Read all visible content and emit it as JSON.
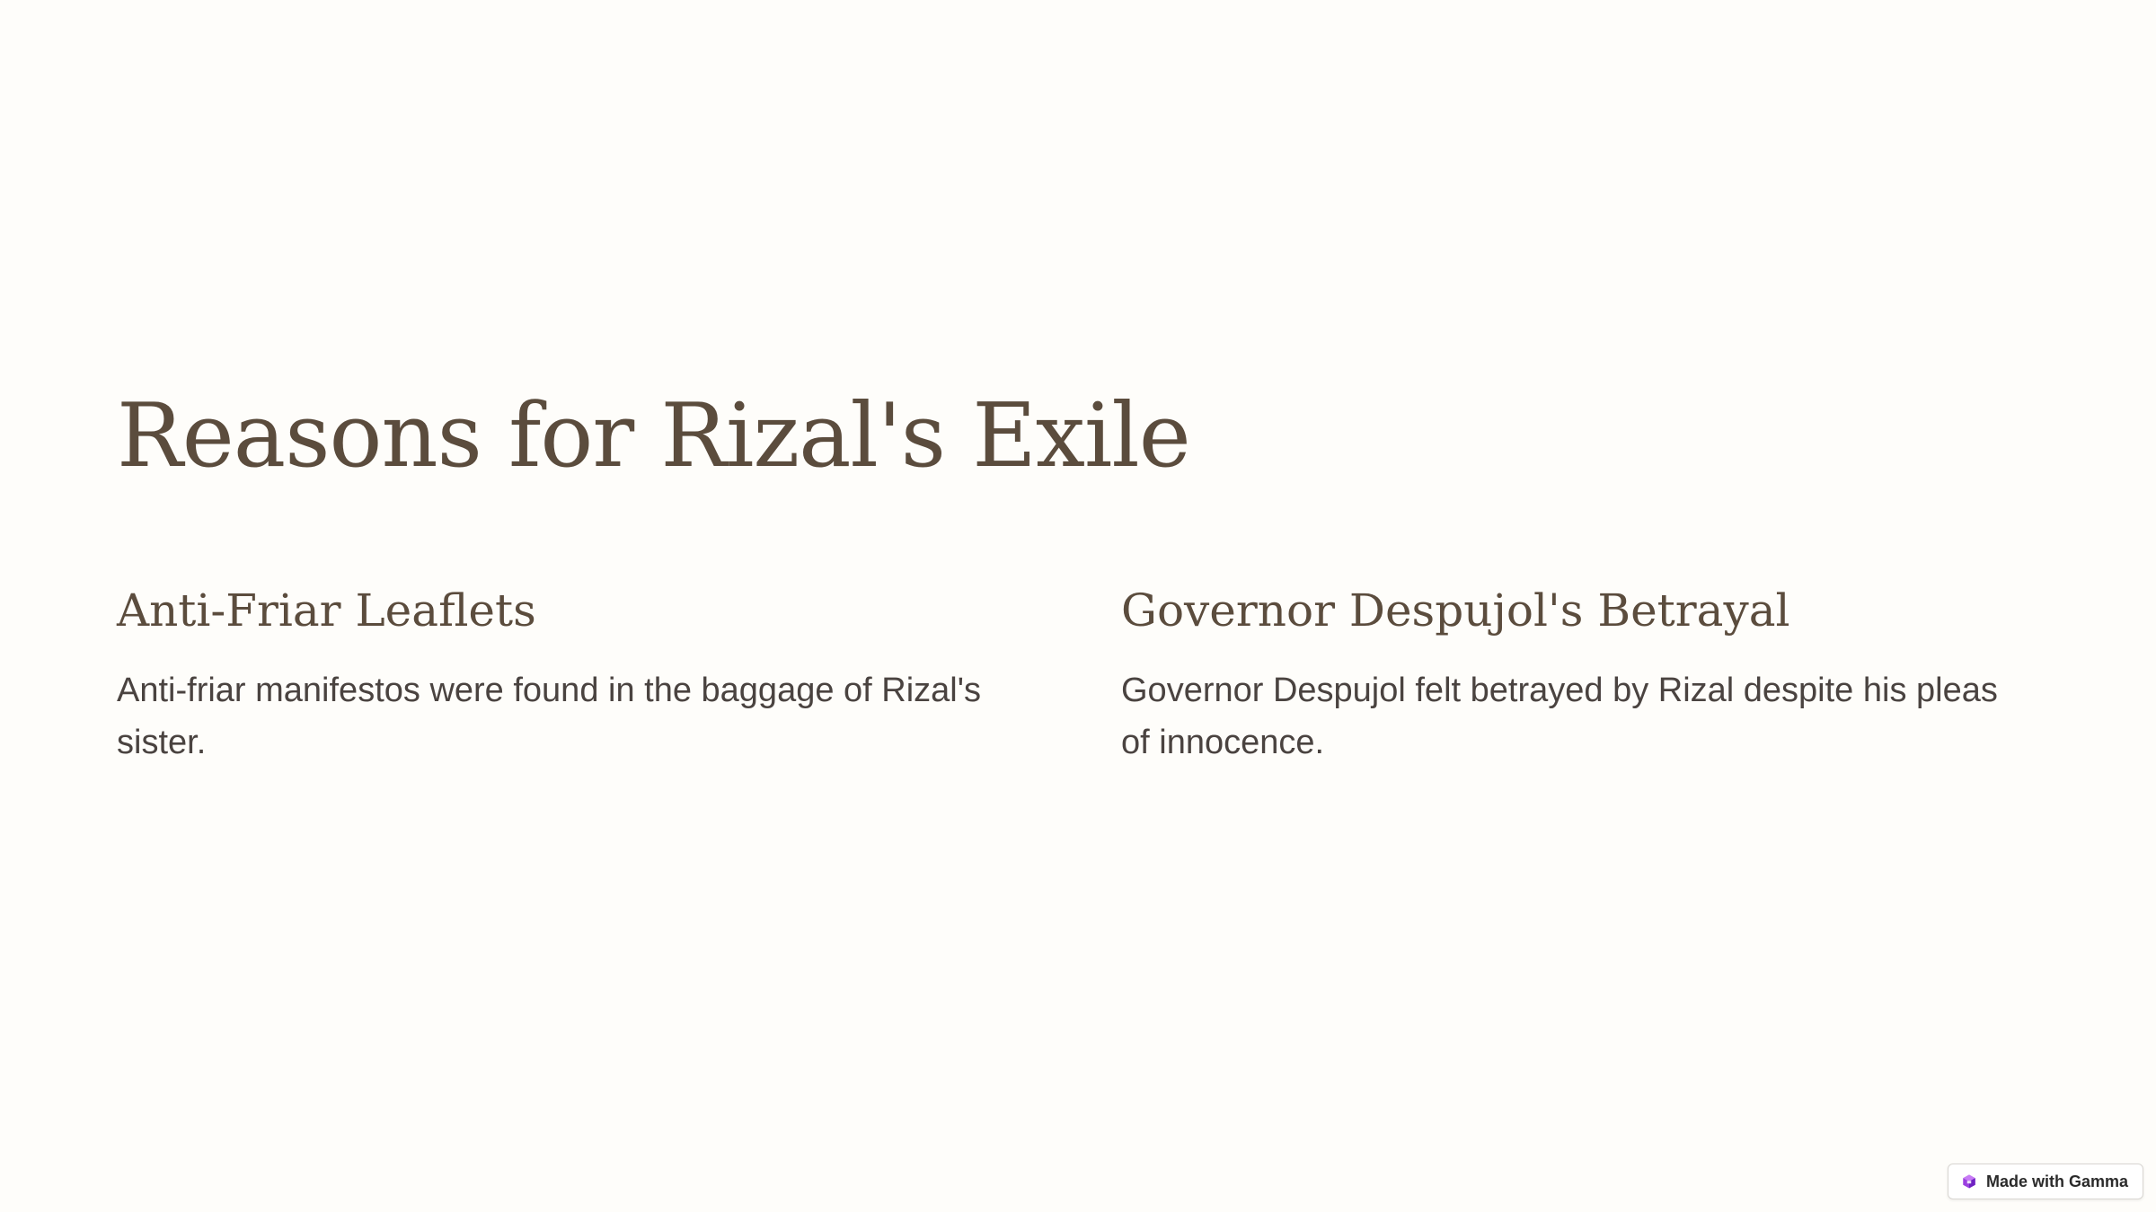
{
  "slide": {
    "title": "Reasons for Rizal's Exile",
    "columns": [
      {
        "heading": "Anti-Friar Leaflets",
        "body": "Anti-friar manifestos were found in the baggage of Rizal's sister."
      },
      {
        "heading": "Governor Despujol's Betrayal",
        "body": "Governor Despujol felt betrayed by Rizal despite his pleas of innocence."
      }
    ]
  },
  "badge": {
    "label": "Made with Gamma",
    "icon": "gamma-logo-icon"
  },
  "colors": {
    "background": "#fefdfa",
    "heading": "#5b4c3d",
    "body_text": "#4a4340",
    "logo_accent": "#9b3fe0"
  }
}
